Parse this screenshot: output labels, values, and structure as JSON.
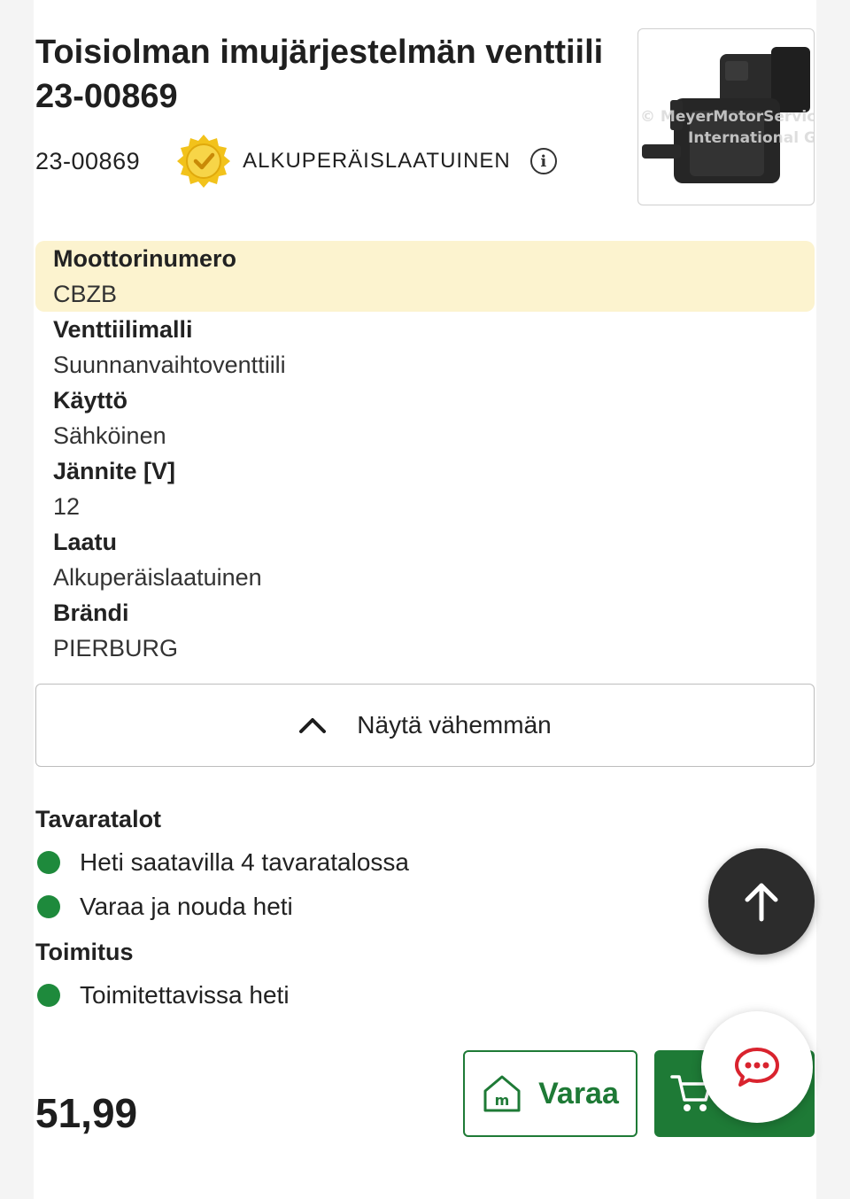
{
  "product": {
    "title": "Toisiolman imujärjestelmän venttiili 23-00869",
    "sku": "23-00869",
    "quality_badge": "ALKUPERÄISLAATUINEN",
    "image_watermark_line1": "© MeyerMotorService",
    "image_watermark_line2": "International GmbH",
    "icons": {
      "badge": "quality-seal-icon",
      "info": "info-icon"
    }
  },
  "specs": [
    {
      "label": "Moottorinumero",
      "value": "CBZB",
      "highlighted": true
    },
    {
      "label": "Venttiilimalli",
      "value": "Suunnanvaihtoventtiili"
    },
    {
      "label": "Käyttö",
      "value": "Sähköinen"
    },
    {
      "label": "Jännite [V]",
      "value": "12"
    },
    {
      "label": "Laatu",
      "value": "Alkuperäislaatuinen"
    },
    {
      "label": "Brändi",
      "value": "PIERBURG"
    }
  ],
  "toggle": {
    "label": "Näytä vähemmän",
    "icon": "chevron-up-icon"
  },
  "availability": {
    "stores_title": "Tavaratalot",
    "stores": [
      "Heti saatavilla 4 tavaratalossa",
      "Varaa ja nouda heti"
    ],
    "delivery_title": "Toimitus",
    "delivery": [
      "Toimitettavissa heti"
    ],
    "status_color": "#1e8a3c"
  },
  "price": "51,99",
  "actions": {
    "reserve_label": "Varaa",
    "reserve_icon": "store-icon",
    "cart_icon": "cart-icon",
    "scroll_top_icon": "arrow-up-icon",
    "chat_icon": "chat-icon"
  },
  "colors": {
    "brand_green": "#1e7a36",
    "highlight": "#fcf3cf",
    "chat_red": "#d9232e"
  }
}
